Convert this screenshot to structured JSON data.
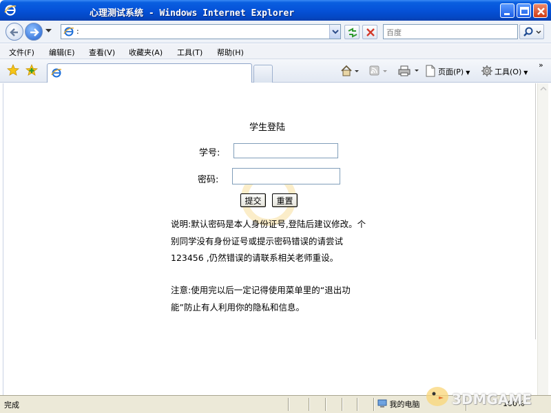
{
  "window": {
    "title": "心理测试系统 - Windows Internet Explorer"
  },
  "address_bar": {
    "url": ":",
    "search_placeholder": "百度"
  },
  "menu": {
    "items": [
      "文件(F)",
      "编辑(E)",
      "查看(V)",
      "收藏夹(A)",
      "工具(T)",
      "帮助(H)"
    ]
  },
  "command_bar": {
    "page_label": "页面(P)",
    "tools_label": "工具(O)"
  },
  "login_form": {
    "title": "学生登陆",
    "student_id_label": "学号:",
    "student_id_value": "",
    "password_label": "密码:",
    "password_value": "",
    "submit_label": "提交",
    "reset_label": "重置",
    "notice_1": "说明:默认密码是本人身份证号,登陆后建议修改。个别同学没有身份证号或提示密码错误的请尝试 123456 ,仍然错误的请联系相关老师重设。",
    "notice_2": "注意:使用完以后一定记得使用菜单里的“退出功能”防止有人利用你的隐私和信息。"
  },
  "status_bar": {
    "status": "完成",
    "zone": "我的电脑",
    "zoom": "100%"
  },
  "watermark": "3DMGAME",
  "colors": {
    "titlebar": "#0552d8",
    "statusbar": "#ece9d8",
    "input_border": "#7f9db9"
  }
}
